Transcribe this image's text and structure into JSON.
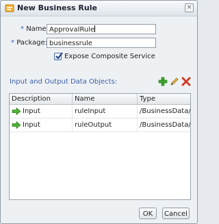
{
  "dialog": {
    "title": "New Business Rule",
    "close_glyph": "×"
  },
  "form": {
    "name_label": "Name:",
    "name_value": "ApprovalRule",
    "package_label": "Package:",
    "package_value": "businessrule",
    "required_marker": "*",
    "expose_label": "Expose Composite Service",
    "expose_checked": true
  },
  "objects": {
    "section_label": "Input and Output Data Objects:",
    "toolbar": {
      "add_icon": "plus-icon",
      "edit_icon": "pencil-icon",
      "delete_icon": "x-icon"
    },
    "columns": [
      "Description",
      "Name",
      "Type"
    ],
    "rows": [
      {
        "description": "Input",
        "name": "ruleInput",
        "type": "/BusinessData/Ru"
      },
      {
        "description": "Input",
        "name": "ruleOutput",
        "type": "/BusinessData/Ru"
      }
    ]
  },
  "footer": {
    "ok_label": "OK",
    "cancel_label": "Cancel"
  },
  "colors": {
    "accent": "#3b5ea9",
    "add_green": "#3ea72d",
    "delete_red": "#d23a24"
  }
}
